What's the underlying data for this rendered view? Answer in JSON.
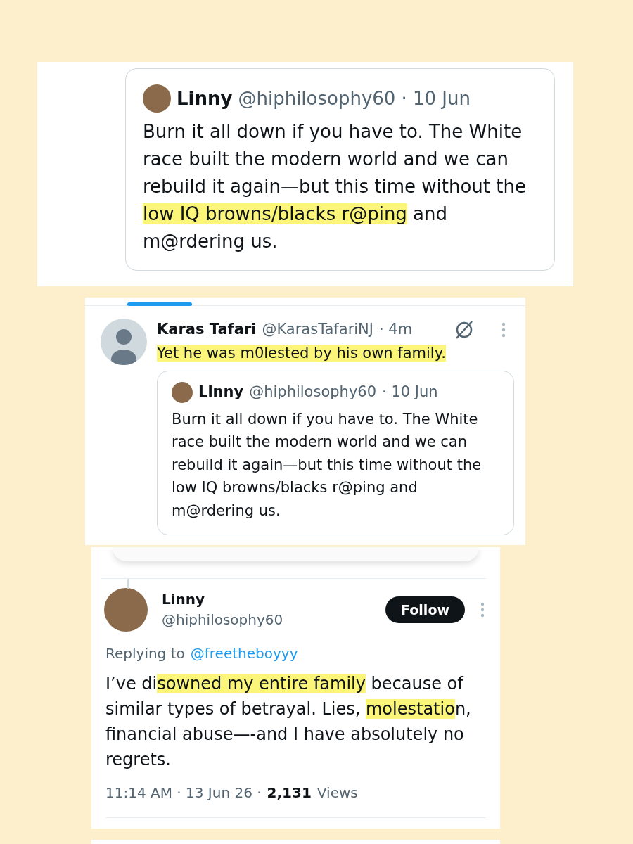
{
  "panels": [
    {
      "kind": "quote",
      "quote": {
        "name": "Linny",
        "handle": "@hiphilosophy60",
        "time": "· 10 Jun",
        "text_parts": [
          {
            "text": "Burn it all down if you have to. The White race built the modern world and we can rebuild it again—but this time without the ",
            "highlighted": false
          },
          {
            "text": "low IQ browns/blacks r@ping",
            "highlighted": true
          },
          {
            "text": " and m@rdering us.",
            "highlighted": false
          }
        ]
      }
    },
    {
      "kind": "reply",
      "author": {
        "name": "Karas Tafari",
        "handle": "@KarasTafariNJ",
        "time": "· 4m"
      },
      "text_parts": [
        {
          "text": "Yet he was m0lested by his own family.",
          "highlighted": true
        }
      ],
      "quote": {
        "name": "Linny",
        "handle": "@hiphilosophy60",
        "time": "· 10 Jun",
        "text_parts": [
          {
            "text": "Burn it all down if you have to. The White race built the modern world and we can rebuild it again—but this time without the low IQ browns/blacks r@ping and m@rdering us.",
            "highlighted": false
          }
        ]
      }
    },
    {
      "kind": "post",
      "author": {
        "name": "Linny",
        "handle": "@hiphilosophy60"
      },
      "follow_label": "Follow",
      "replying_prefix": "Replying to",
      "replying_to": "@freetheboyyy",
      "text_parts": [
        {
          "text": "I’ve di",
          "highlighted": false
        },
        {
          "text": "sowned my entire family",
          "highlighted": true
        },
        {
          "text": " because of similar types of betrayal. Lies, ",
          "highlighted": false
        },
        {
          "text": "molestatio",
          "highlighted": true
        },
        {
          "text": "n, financial abuse—-and I have absolutely no regrets.",
          "highlighted": false
        }
      ],
      "meta": {
        "time": "11:14 AM · 13 Jun 26 ·",
        "views_count": "2,131",
        "views_label": "Views"
      }
    }
  ]
}
